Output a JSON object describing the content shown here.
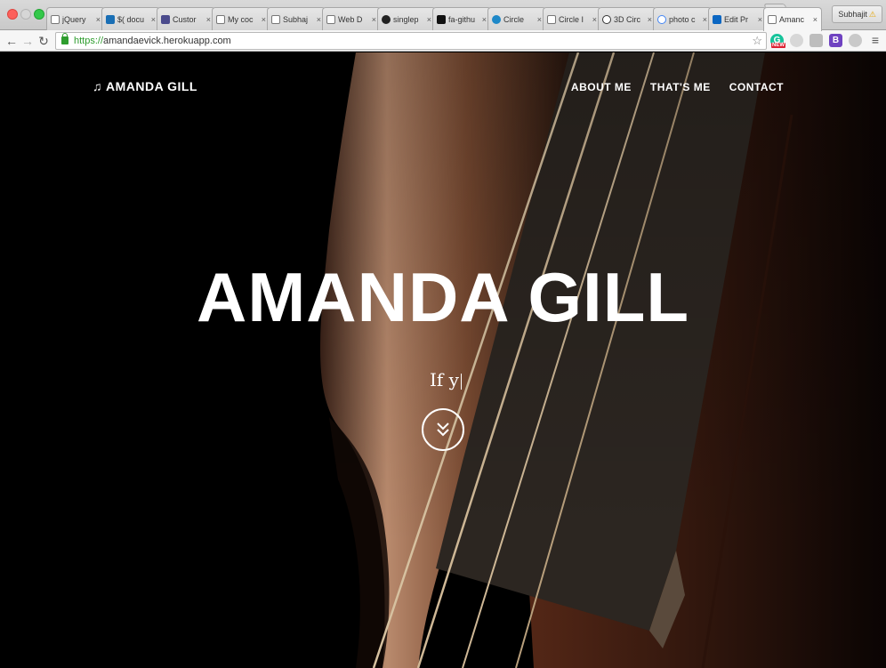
{
  "browser": {
    "tabs": [
      {
        "label": "jQuery",
        "icon": "page-icon"
      },
      {
        "label": "$( docu",
        "icon": "jquery-icon"
      },
      {
        "label": "Custor",
        "icon": "html-icon"
      },
      {
        "label": "My coc",
        "icon": "page-icon"
      },
      {
        "label": "Subhaj",
        "icon": "page-icon"
      },
      {
        "label": "Web D",
        "icon": "page-icon"
      },
      {
        "label": "singlep",
        "icon": "github-icon"
      },
      {
        "label": "fa-githu",
        "icon": "flag-icon"
      },
      {
        "label": "Circle",
        "icon": "circle-icon"
      },
      {
        "label": "Circle I",
        "icon": "page-icon"
      },
      {
        "label": "3D Circ",
        "icon": "codepen-icon"
      },
      {
        "label": "photo c",
        "icon": "google-icon"
      },
      {
        "label": "Edit Pr",
        "icon": "linkedin-icon"
      },
      {
        "label": "Amanc",
        "icon": "page-icon",
        "active": true
      }
    ],
    "profile_name": "Subhajit",
    "url_scheme": "https://",
    "url_host": "amandaevick.herokuapp.com",
    "extensions": [
      "grammarly-icon",
      "extension-icon",
      "extension-icon",
      "bootstrap-icon",
      "extension-icon"
    ],
    "grammarly_badge": "NEW",
    "bootstrap_letter": "B"
  },
  "site": {
    "brand": "AMANDA GILL",
    "brand_icon": "music-note-icon",
    "nav": [
      "ABOUT ME",
      "THAT'S ME",
      "CONTACT"
    ],
    "headline": "AMANDA GILL",
    "tagline": "If y",
    "scroll_icon": "double-chevron-down-icon",
    "colors": {
      "text": "#ffffff",
      "background": "#000000",
      "wood": "#8a5a40"
    }
  }
}
